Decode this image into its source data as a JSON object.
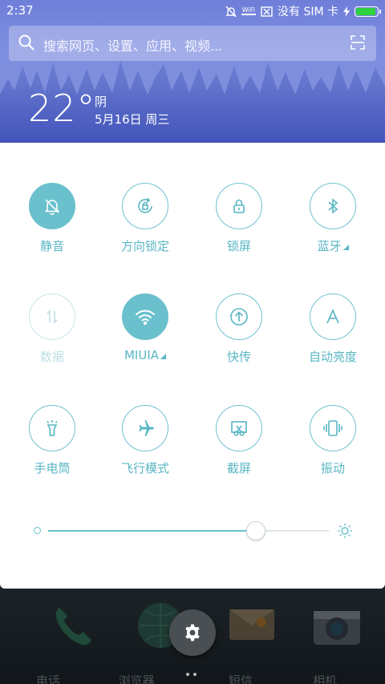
{
  "status_bar": {
    "time": "2:37",
    "wifi_label": "WiFi",
    "sim_text": "没有 SIM 卡",
    "battery_level": 1.0,
    "battery_color": "#2fd13f"
  },
  "search": {
    "placeholder": "搜索网页、设置、应用、视频..."
  },
  "weather": {
    "temperature": "22°",
    "condition": "阴",
    "date": "5月16日 周三"
  },
  "toggles": [
    {
      "label": "静音",
      "icon": "bell-off-icon",
      "state": "on"
    },
    {
      "label": "方向锁定",
      "icon": "rotation-lock-icon",
      "state": "off"
    },
    {
      "label": "锁屏",
      "icon": "lock-icon",
      "state": "off"
    },
    {
      "label": "蓝牙",
      "icon": "bluetooth-icon",
      "state": "off",
      "has_more": true
    },
    {
      "label": "数据",
      "icon": "data-arrows-icon",
      "state": "disabled"
    },
    {
      "label": "MIUIA",
      "icon": "wifi-icon",
      "state": "on",
      "has_more": true
    },
    {
      "label": "快传",
      "icon": "upload-icon",
      "state": "off"
    },
    {
      "label": "自动亮度",
      "icon": "auto-brightness-icon",
      "state": "off"
    },
    {
      "label": "手电筒",
      "icon": "flashlight-icon",
      "state": "off"
    },
    {
      "label": "飞行模式",
      "icon": "airplane-icon",
      "state": "off"
    },
    {
      "label": "截屏",
      "icon": "screenshot-icon",
      "state": "off"
    },
    {
      "label": "振动",
      "icon": "vibrate-icon",
      "state": "off"
    }
  ],
  "brightness": {
    "level": 0.74
  },
  "dock": [
    {
      "label": "电话",
      "icon": "phone-icon"
    },
    {
      "label": "浏览器",
      "icon": "browser-icon"
    },
    {
      "label": "短信",
      "icon": "messages-icon"
    },
    {
      "label": "相机",
      "icon": "camera-icon"
    }
  ],
  "colors": {
    "accent": "#6ac0cd",
    "header_blue": "#7f8fdd"
  }
}
